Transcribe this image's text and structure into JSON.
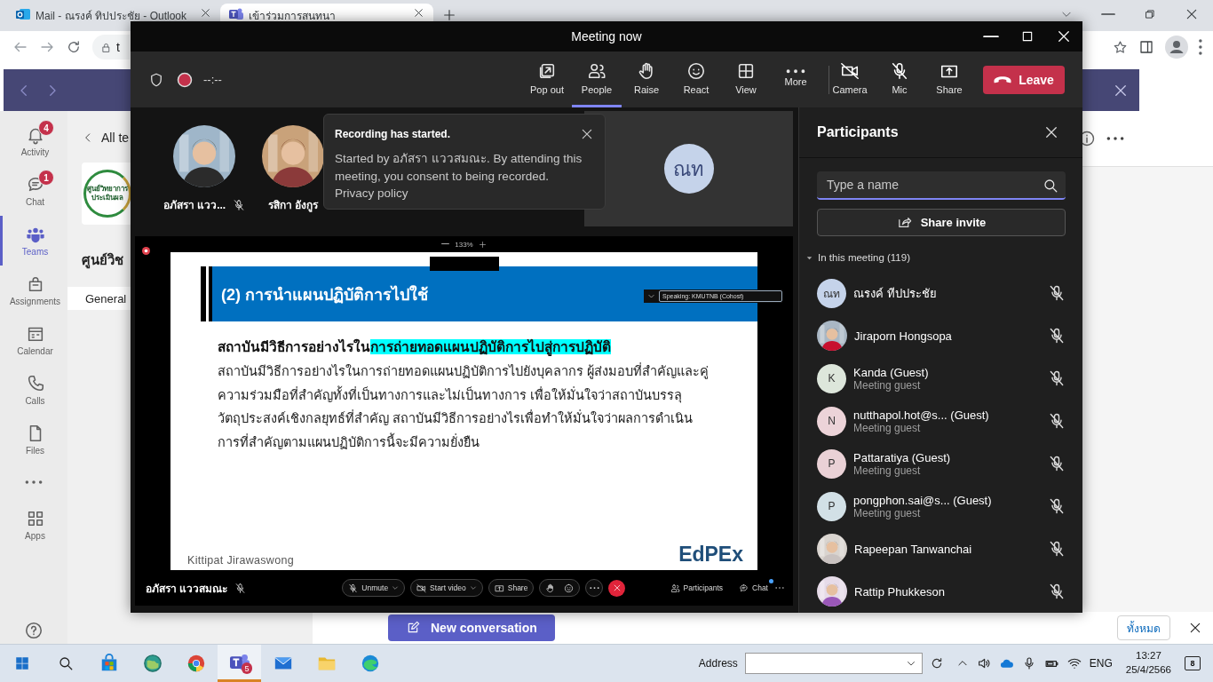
{
  "browser": {
    "tabs": [
      {
        "title": "Mail - ณรงค์ ทิปประชัย - Outlook",
        "selected": false
      },
      {
        "title": "เข้าร่วมการสนทนา",
        "selected": true
      }
    ],
    "address": "t"
  },
  "teams": {
    "rail": [
      {
        "label": "Activity",
        "badge": "4",
        "selected": false
      },
      {
        "label": "Chat",
        "badge": "1",
        "selected": false
      },
      {
        "label": "Teams",
        "selected": true
      },
      {
        "label": "Assignments",
        "selected": false
      },
      {
        "label": "Calendar",
        "selected": false
      },
      {
        "label": "Calls",
        "selected": false
      },
      {
        "label": "Files",
        "selected": false
      },
      {
        "label": "Apps",
        "selected": false
      }
    ],
    "back_link": "All te",
    "logo_text": [
      "ศูนย์วิทยาการ",
      "ประเมินผล"
    ],
    "team_name": "ศูนย์วิช",
    "channel": "General",
    "new_conversation": "New conversation",
    "banner_button": "ทั้งหมด"
  },
  "meeting": {
    "title": "Meeting now",
    "recording": true,
    "timer": "--:--",
    "toolbar": [
      {
        "label": "Pop out",
        "selected": false
      },
      {
        "label": "People",
        "selected": true
      },
      {
        "label": "Raise",
        "selected": false
      },
      {
        "label": "React",
        "selected": false
      },
      {
        "label": "View",
        "selected": false
      },
      {
        "label": "More",
        "selected": false
      }
    ],
    "devices": [
      {
        "label": "Camera",
        "off": true
      },
      {
        "label": "Mic",
        "off": true
      }
    ],
    "share": "Share",
    "leave": "Leave",
    "tiles": [
      {
        "name": "อภัสรา แวว...",
        "muted": true
      },
      {
        "name": "รสิกา อังกูร",
        "muted": false
      }
    ],
    "initials_tile": "ณท",
    "toast": {
      "title": "Recording has started.",
      "text": "Started by อภัสรา แววสมณะ. By attending this meeting, you consent to being recorded.",
      "link": "Privacy policy"
    },
    "shared_screen": {
      "zoom": "133%",
      "speaking": "Speaking: KMUTNB (Cohost)",
      "slide_title": "(2) การนำแผนปฏิบัติการไปใช้",
      "question_lead": "สถาบันมีวิธีการอย่างไรใน",
      "question_highlight": "การถ่ายทอดแผนปฏิบัติการไปสู่การปฏิบัติ",
      "paragraph": "สถาบันมีวิธีการอย่างไรในการถ่ายทอดแผนปฏิบัติการไปยังบุคลากร ผู้ส่งมอบที่สำคัญและคู่ความร่วมมือที่สำคัญทั้งที่เป็นทางการและไม่เป็นทางการ เพื่อให้มั่นใจว่าสถาบันบรรลุวัตถุประสงค์เชิงกลยุทธ์ที่สำคัญ สถาบันมีวิธีการอย่างไรเพื่อทำให้มั่นใจว่าผลการดำเนินการที่สำคัญตามแผนปฏิบัติการนี้จะมีความยั่งยืน",
      "author": "Kittipat Jirawaswong",
      "brand": "EdPEx",
      "presenter": "อภัสรา แววสมณะ",
      "presenter_muted": true,
      "controls": [
        "Unmute",
        "Start video",
        "Share"
      ],
      "side_controls": [
        "Participants",
        "Chat"
      ]
    },
    "participants": {
      "title": "Participants",
      "search_placeholder": "Type a name",
      "share_invite": "Share invite",
      "section": "In this meeting (119)",
      "expanded": true,
      "people": [
        {
          "kind": "initials",
          "initials": "ณท",
          "color": "#c5d3ea",
          "name": "ณรงค์ ทีปประชัย",
          "muted": true
        },
        {
          "kind": "picture",
          "name": "Jiraporn Hongsopa",
          "muted": true
        },
        {
          "kind": "initials",
          "initials": "K",
          "color": "#dde6db",
          "name": "Kanda (Guest)",
          "role": "Meeting guest",
          "muted": true
        },
        {
          "kind": "initials",
          "initials": "N",
          "color": "#ecd3d8",
          "name": "nutthapol.hot@s... (Guest)",
          "role": "Meeting guest",
          "muted": true
        },
        {
          "kind": "initials",
          "initials": "P",
          "color": "#ead1d6",
          "name": "Pattaratiya (Guest)",
          "role": "Meeting guest",
          "muted": true
        },
        {
          "kind": "initials",
          "initials": "P",
          "color": "#d2e0e6",
          "name": "pongphon.sai@s... (Guest)",
          "role": "Meeting guest",
          "muted": true
        },
        {
          "kind": "picture",
          "name": "Rapeepan Tanwanchai",
          "muted": true
        },
        {
          "kind": "picture",
          "name": "Rattip Phukkeson",
          "muted": true
        }
      ]
    }
  },
  "taskbar": {
    "apps": [
      {
        "selected": false
      },
      {
        "selected": false
      },
      {
        "selected": false
      },
      {
        "selected": false
      },
      {
        "selected": false
      },
      {
        "selected": true,
        "badge": "5"
      },
      {
        "selected": false
      },
      {
        "selected": false
      },
      {
        "selected": false
      }
    ],
    "address_label": "Address",
    "language": "ENG",
    "time": "13:27",
    "date": "25/4/2566",
    "notifications": "8"
  }
}
